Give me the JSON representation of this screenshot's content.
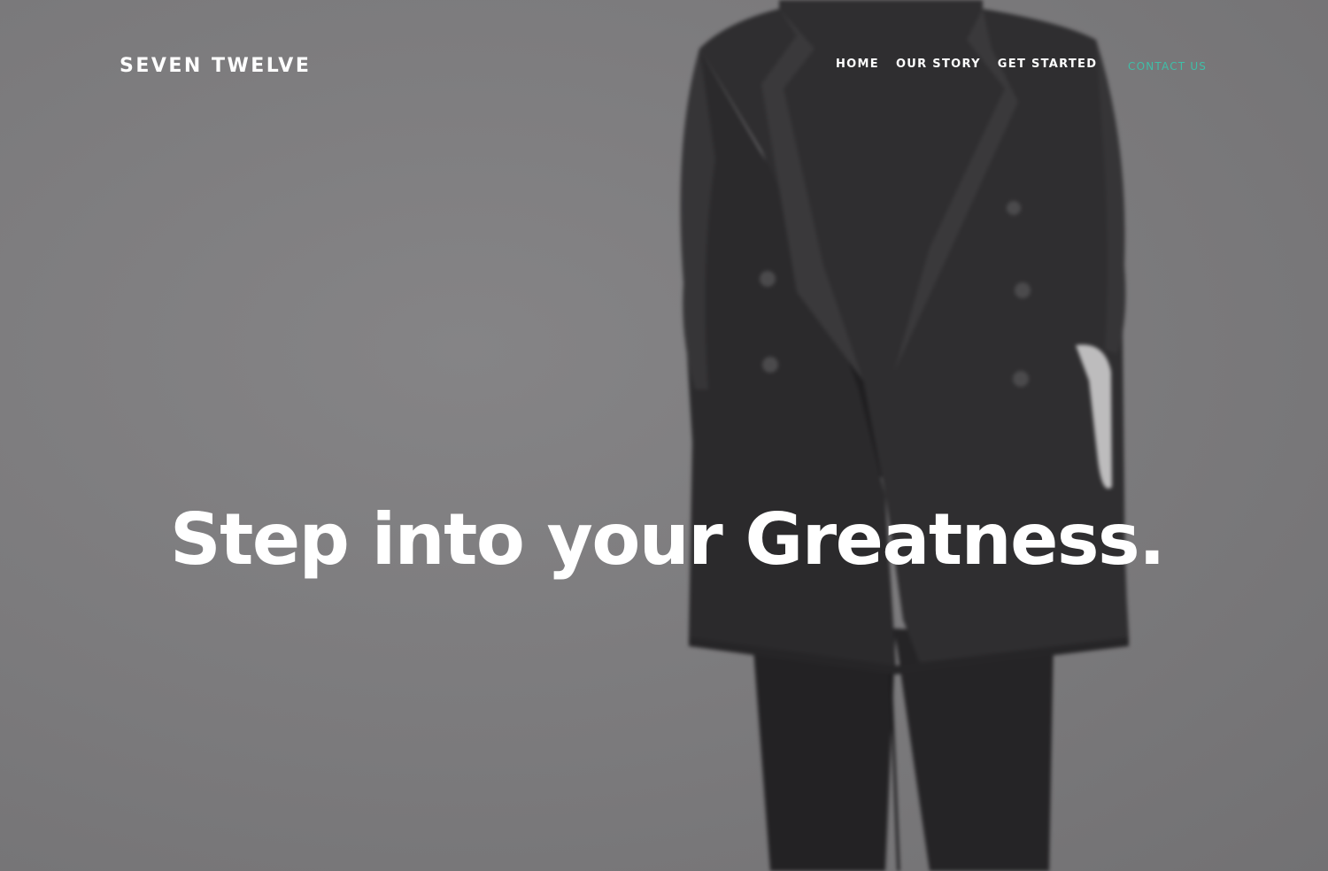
{
  "header": {
    "logo": "SEVEN TWELVE",
    "nav": [
      {
        "label": "HOME"
      },
      {
        "label": "OUR STORY"
      },
      {
        "label": "GET STARTED"
      }
    ],
    "contact_label": "CONTACT US"
  },
  "hero": {
    "headline": "Step into your Greatness.",
    "background_image": "person-in-oversized-black-blazer-photo"
  },
  "colors": {
    "background": "#7d7c7e",
    "text": "#ffffff",
    "accent": "#3fbfa8",
    "garment": "#2a292b"
  }
}
